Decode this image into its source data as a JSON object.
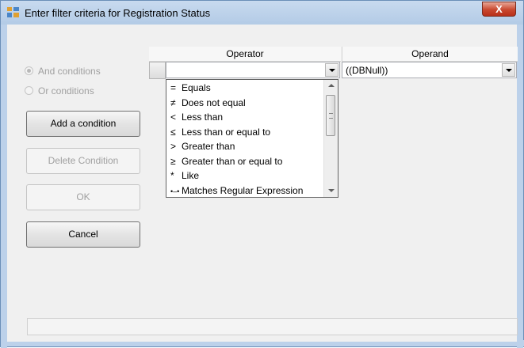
{
  "window": {
    "title": "Enter filter criteria for Registration Status",
    "close_label": "X"
  },
  "conditions": {
    "and_label": "And conditions",
    "or_label": "Or conditions",
    "selected": "And conditions"
  },
  "buttons": {
    "add": "Add a condition",
    "delete": "Delete Condition",
    "ok": "OK",
    "cancel": "Cancel"
  },
  "grid": {
    "headers": [
      "Operator",
      "Operand"
    ],
    "operator_value": "",
    "operand_value": "((DBNull))"
  },
  "operator_dropdown": {
    "items": [
      {
        "symbol": "=",
        "label": "Equals"
      },
      {
        "symbol": "≠",
        "label": "Does not equal"
      },
      {
        "symbol": "<",
        "label": "Less than"
      },
      {
        "symbol": "≤",
        "label": "Less than or equal to"
      },
      {
        "symbol": ">",
        "label": "Greater than"
      },
      {
        "symbol": "≥",
        "label": "Greater than or equal to"
      },
      {
        "symbol": "*",
        "label": "Like"
      },
      {
        "symbol": "•–•",
        "label": "Matches Regular Expression"
      }
    ]
  }
}
